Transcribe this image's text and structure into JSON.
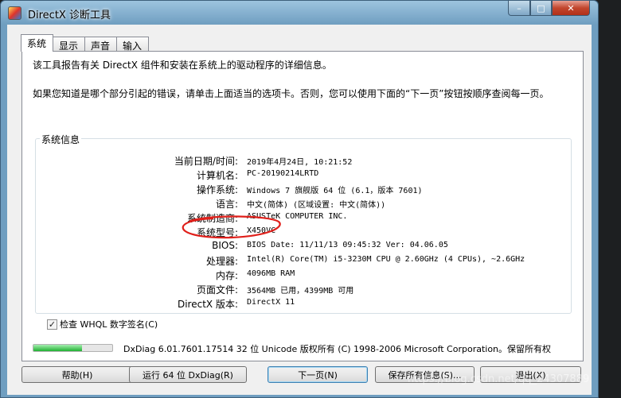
{
  "window": {
    "title": "DirectX 诊断工具",
    "controls": {
      "minimize": "–",
      "maximize": "□",
      "close": "✕"
    }
  },
  "tabs": [
    {
      "label": "系统",
      "active": true
    },
    {
      "label": "显示",
      "active": false
    },
    {
      "label": "声音",
      "active": false
    },
    {
      "label": "输入",
      "active": false
    }
  ],
  "intro": {
    "line1": "该工具报告有关 DirectX 组件和安装在系统上的驱动程序的详细信息。",
    "line2": "如果您知道是哪个部分引起的错误，请单击上面适当的选项卡。否则，您可以使用下面的“下一页”按钮按顺序查阅每一页。"
  },
  "system_info": {
    "group_title": "系统信息",
    "rows": [
      {
        "label": "当前日期/时间:",
        "value": "2019年4月24日, 10:21:52"
      },
      {
        "label": "计算机名:",
        "value": "PC-20190214LRTD"
      },
      {
        "label": "操作系统:",
        "value": "Windows 7 旗舰版 64 位 (6.1，版本 7601)"
      },
      {
        "label": "语言:",
        "value": "中文(简体) (区域设置: 中文(简体))"
      },
      {
        "label": "系统制造商:",
        "value": "ASUSTeK COMPUTER INC."
      },
      {
        "label": "系统型号:",
        "value": "X450VC"
      },
      {
        "label": "BIOS:",
        "value": "BIOS Date: 11/11/13 09:45:32 Ver: 04.06.05"
      },
      {
        "label": "处理器:",
        "value": "Intel(R) Core(TM) i5-3230M CPU @ 2.60GHz (4 CPUs), ~2.6GHz"
      },
      {
        "label": "内存:",
        "value": "4096MB RAM"
      },
      {
        "label": "页面文件:",
        "value": "3564MB 已用，4399MB 可用"
      },
      {
        "label": "DirectX 版本:",
        "value": "DirectX 11"
      }
    ]
  },
  "whql_check": {
    "label": "检查 WHQL 数字签名(C)",
    "checked": true
  },
  "progress": {
    "fraction": 0.62,
    "color": "#1fb131"
  },
  "copyright": "DxDiag 6.01.7601.17514 32 位 Unicode 版权所有 (C) 1998-2006 Microsoft Corporation。保留所有权",
  "buttons": {
    "help": "帮助(H)",
    "run64": "运行 64 位 DxDiag(R)",
    "next": "下一页(N)",
    "save": "保存所有信息(S)...",
    "exit": "退出(X)"
  },
  "watermark": "https://blog.csdn.net/qq_24307889",
  "annotation_color": "#e0201b"
}
